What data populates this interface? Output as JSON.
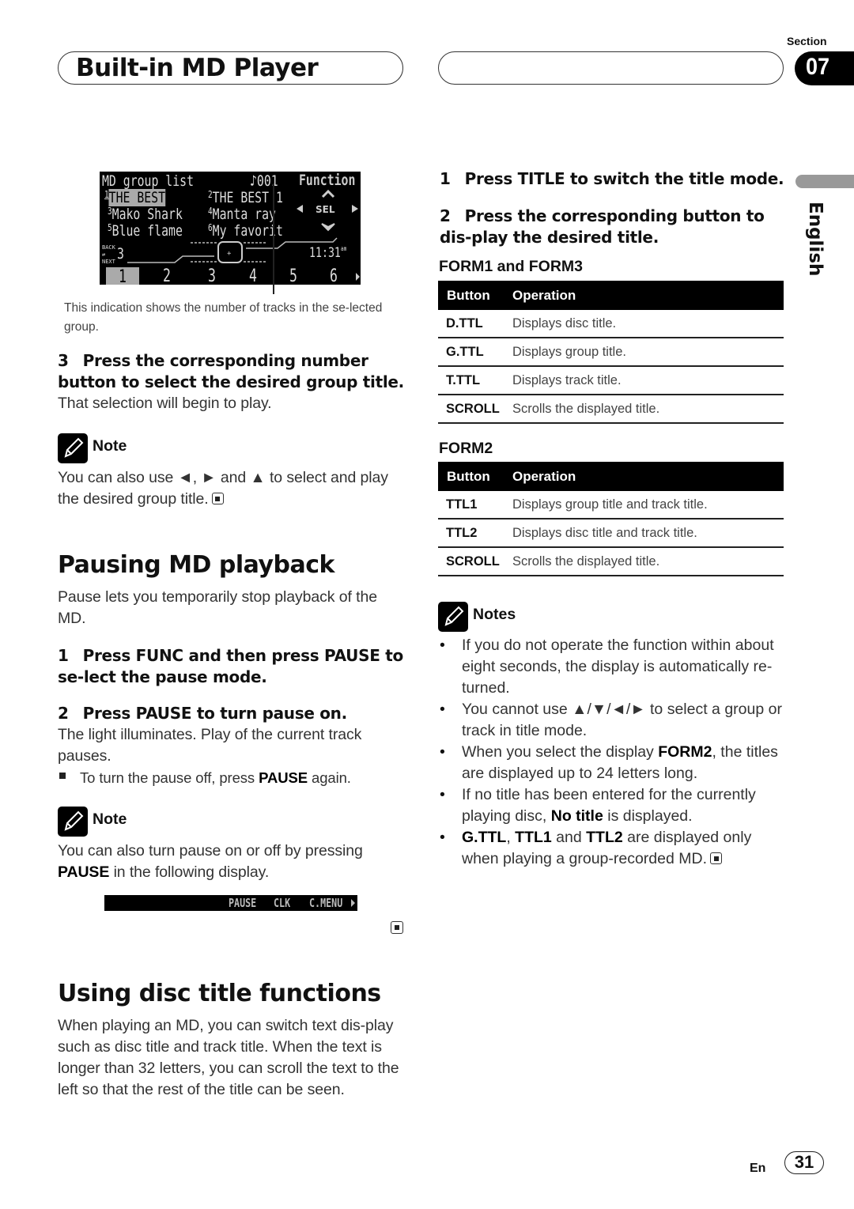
{
  "header": {
    "chapter_title": "Built-in MD Player",
    "section_label": "Section",
    "section_number": "07"
  },
  "side_tab": {
    "language": "English"
  },
  "lcd_display": {
    "title": "MD group list",
    "disc_number": "001",
    "function_label": "Function",
    "groups": [
      {
        "num": "1",
        "name": "THE BEST",
        "selected": true
      },
      {
        "num": "2",
        "name": "THE BEST 1"
      },
      {
        "num": "3",
        "name": "Mako Shark"
      },
      {
        "num": "4",
        "name": "Manta ray"
      },
      {
        "num": "5",
        "name": "Blue flame"
      },
      {
        "num": "6",
        "name": "My favorit"
      }
    ],
    "sel_label": "SEL",
    "back_label": "BACK",
    "next_label": "NEXT",
    "track_count": "3",
    "clock": "11:31",
    "clock_suffix": "am",
    "number_buttons": [
      "1",
      "2",
      "3",
      "4",
      "5",
      "6"
    ]
  },
  "left": {
    "caption": "This indication shows the number of tracks in the se-lected group.",
    "step3": {
      "num": "3",
      "text": "Press the corresponding number button to select the desired group title."
    },
    "step3_body": "That selection will begin to play.",
    "note1_label": "Note",
    "note1_text": "You can also use ◄, ► and ▲ to select and play the desired group title.",
    "pausing": {
      "heading": "Pausing MD playback",
      "intro": "Pause lets you temporarily stop playback of the MD.",
      "step1": {
        "num": "1",
        "text": "Press FUNC and then press PAUSE to se-lect the pause mode."
      },
      "step2": {
        "num": "2",
        "text": "Press PAUSE to turn pause on."
      },
      "step2_body": "The light illuminates. Play of the current track pauses.",
      "bullet_pre": "To turn the pause off, press ",
      "bullet_bold": "PAUSE",
      "bullet_post": " again.",
      "note_label": "Note",
      "note_pre": "You can also turn pause on or off by pressing ",
      "note_bold": "PAUSE",
      "note_post": " in the following display.",
      "display_items": [
        "PAUSE",
        "CLK",
        "C.MENU"
      ]
    },
    "disc_title": {
      "heading": "Using disc title functions",
      "body": "When playing an MD, you can switch text dis-play such as disc title and track title. When the text is longer than 32 letters, you can scroll the text to the left so that the rest of the title can be seen."
    }
  },
  "right": {
    "step1": {
      "num": "1",
      "text": "Press TITLE to switch the title mode."
    },
    "step2": {
      "num": "2",
      "text": "Press the corresponding button to dis-play the desired title."
    },
    "form1_heading": "FORM1 and FORM3",
    "form1_table": {
      "headers": [
        "Button",
        "Operation"
      ],
      "rows": [
        [
          "D.TTL",
          "Displays disc title."
        ],
        [
          "G.TTL",
          "Displays group title."
        ],
        [
          "T.TTL",
          "Displays track title."
        ],
        [
          "SCROLL",
          "Scrolls the displayed title."
        ]
      ]
    },
    "form2_heading": "FORM2",
    "form2_table": {
      "headers": [
        "Button",
        "Operation"
      ],
      "rows": [
        [
          "TTL1",
          "Displays group title and track title."
        ],
        [
          "TTL2",
          "Displays disc title and track title."
        ],
        [
          "SCROLL",
          "Scrolls the displayed title."
        ]
      ]
    },
    "notes_label": "Notes",
    "notes": [
      {
        "pre": "If you do not operate the function within about eight seconds, the display is automatically re-turned."
      },
      {
        "pre": "You cannot use ▲/▼/◄/► to select a group or track in title mode."
      },
      {
        "pre": "When you select the display ",
        "b1": "FORM2",
        "post": ", the titles are displayed up to 24 letters long."
      },
      {
        "pre": "If no title has been entered for the currently playing disc, ",
        "b1": "No title",
        "post": " is displayed."
      },
      {
        "b1": "G.TTL",
        "mid1": ", ",
        "b2": "TTL1",
        "mid2": " and ",
        "b3": "TTL2",
        "post": " are displayed only when playing a group-recorded MD."
      }
    ]
  },
  "footer": {
    "lang_code": "En",
    "page_number": "31"
  }
}
